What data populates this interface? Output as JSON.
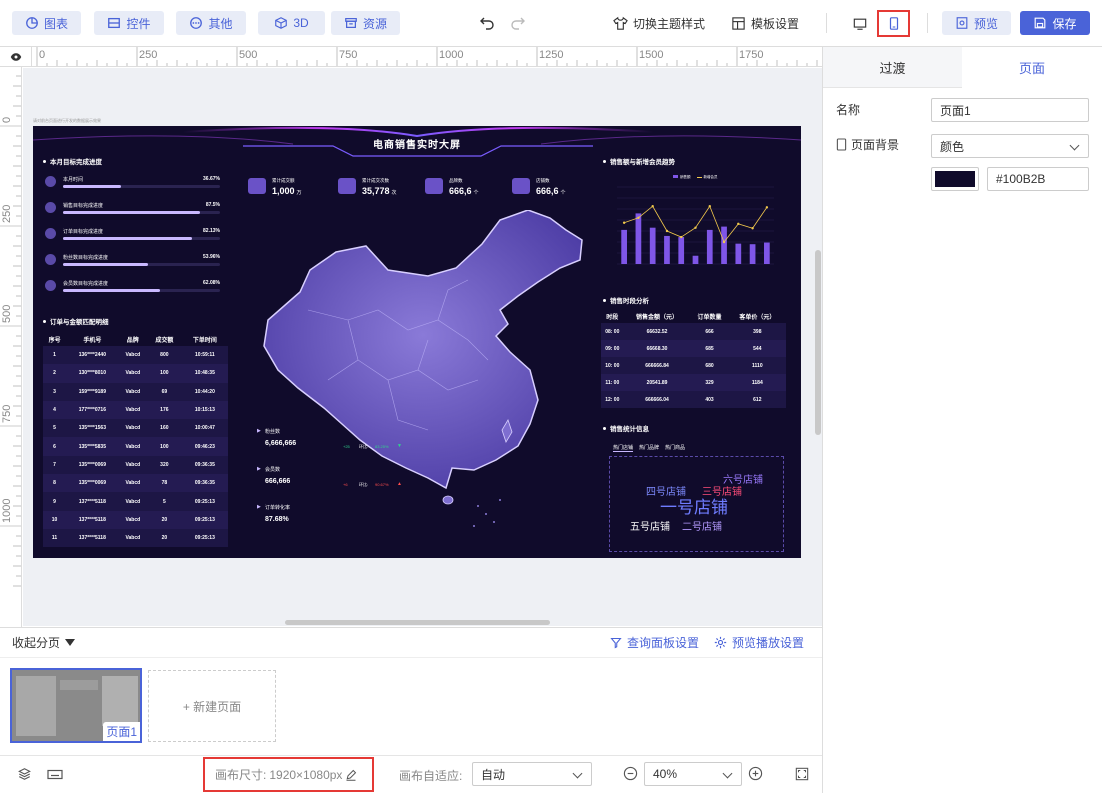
{
  "toolbar": {
    "chart_label": "图表",
    "widget_label": "控件",
    "other_label": "其他",
    "threed_label": "3D",
    "resource_label": "资源",
    "theme_label": "切换主题样式",
    "template_label": "模板设置",
    "preview_label": "预览",
    "save_label": "保存"
  },
  "ruler": {
    "h_ticks": [
      "0",
      "250",
      "500",
      "750",
      "1000",
      "1250",
      "1500",
      "1750"
    ],
    "v_ticks": [
      "0",
      "250",
      "500",
      "750",
      "1000"
    ]
  },
  "dashboard": {
    "hint": "请对前台页面进行开发的数据展示效果",
    "title": "电商销售实时大屏",
    "month_progress_title": "本月目标完成进度",
    "progress": [
      {
        "label": "本月时间",
        "pct": "36.67%",
        "value": 36.67
      },
      {
        "label": "销售目标完成进度",
        "pct": "87.5%",
        "value": 87.5
      },
      {
        "label": "订单目标完成进度",
        "pct": "82.13%",
        "value": 82.13
      },
      {
        "label": "粉丝数目标完成进度",
        "pct": "53.96%",
        "value": 53.96
      },
      {
        "label": "会员数目标完成进度",
        "pct": "62.08%",
        "value": 62.08
      }
    ],
    "orders_title": "订单与金额匹配明细",
    "orders_headers": [
      "序号",
      "手机号",
      "品牌",
      "成交额",
      "下单时间"
    ],
    "orders_rows": [
      [
        "1",
        "136****2440",
        "Vabcd",
        "800",
        "10:59:11"
      ],
      [
        "2",
        "130****8010",
        "Vabcd",
        "100",
        "10:48:35"
      ],
      [
        "3",
        "159****9189",
        "Vabcd",
        "69",
        "10:44:20"
      ],
      [
        "4",
        "177****0716",
        "Vabcd",
        "176",
        "10:15:13"
      ],
      [
        "5",
        "135****1563",
        "Vabcd",
        "160",
        "10:00:47"
      ],
      [
        "6",
        "135****5835",
        "Vabcd",
        "100",
        "09:46:23"
      ],
      [
        "7",
        "135****0069",
        "Vabcd",
        "320",
        "09:36:35"
      ],
      [
        "8",
        "135****0069",
        "Vabcd",
        "78",
        "09:36:35"
      ],
      [
        "9",
        "137****5118",
        "Vabcd",
        "5",
        "09:25:13"
      ],
      [
        "10",
        "137****5118",
        "Vabcd",
        "20",
        "09:25:13"
      ],
      [
        "11",
        "137****5118",
        "Vabcd",
        "20",
        "09:25:13"
      ]
    ],
    "kpis": [
      {
        "label": "累计成交额",
        "value": "1,000",
        "unit": "万"
      },
      {
        "label": "累计成交次数",
        "value": "35,778",
        "unit": "次"
      },
      {
        "label": "品牌数",
        "value": "666,6",
        "unit": "个"
      },
      {
        "label": "店铺数",
        "value": "666,6",
        "unit": "个"
      }
    ],
    "stats": [
      {
        "label": "粉丝数",
        "value": "6,666,666",
        "delta": "+25",
        "ratio_label": "环比:",
        "ratio": "83.25%",
        "dir": "down"
      },
      {
        "label": "会员数",
        "value": "666,666",
        "delta": "+6",
        "ratio_label": "环比:",
        "ratio": "90.67%",
        "dir": "up"
      },
      {
        "label": "订单转化率",
        "value": "87.68%"
      }
    ],
    "trend_title": "销售额与新增会员趋势",
    "trend_legend": [
      "销售额",
      "新增会员"
    ],
    "sales_period_title": "销售时段分析",
    "sales_headers": [
      "时段",
      "销售金额（元）",
      "订单数量",
      "客单价（元）"
    ],
    "sales_rows": [
      [
        "08: 00",
        "66632.52",
        "666",
        "398"
      ],
      [
        "09: 00",
        "66668.30",
        "685",
        "544"
      ],
      [
        "10: 00",
        "666666.84",
        "680",
        "1110"
      ],
      [
        "11: 00",
        "20541.89",
        "329",
        "1184"
      ],
      [
        "12: 00",
        "666666.04",
        "403",
        "612"
      ]
    ],
    "stat_info_title": "销售统计信息",
    "stat_tabs": [
      "热门店铺",
      "热门品牌",
      "热门商品"
    ],
    "words": [
      {
        "text": "六号店铺",
        "color": "#9b7bff"
      },
      {
        "text": "四号店铺",
        "color": "#7e8bff"
      },
      {
        "text": "三号店铺",
        "color": "#ff4d7a"
      },
      {
        "text": "一号店铺",
        "color": "#6f7cff"
      },
      {
        "text": "五号店铺",
        "color": "#ffffff"
      },
      {
        "text": "二号店铺",
        "color": "#b59bff"
      }
    ]
  },
  "chart_data": {
    "type": "bar",
    "title": "销售额与新增会员趋势",
    "categories": [
      "",
      "",
      "",
      "",
      "",
      "",
      "",
      "",
      "",
      "",
      ""
    ],
    "series": [
      {
        "name": "销售额",
        "values": [
          620,
          920,
          660,
          510,
          490,
          150,
          620,
          680,
          370,
          360,
          390
        ]
      },
      {
        "name": "新增会员",
        "values": [
          750,
          840,
          1050,
          600,
          490,
          660,
          1050,
          400,
          730,
          650,
          1030
        ]
      }
    ],
    "ylim": [
      0,
      1400
    ]
  },
  "pages": {
    "collapse_label": "收起分页",
    "query_settings": "查询面板设置",
    "preview_play_settings": "预览播放设置",
    "page1_label": "页面1",
    "new_page_label": "+ 新建页面"
  },
  "bottom": {
    "canvas_size_label": "画布尺寸:",
    "canvas_size_value": "1920×1080px",
    "adapt_label": "画布自适应:",
    "adapt_value": "自动",
    "zoom_value": "40%"
  },
  "right_panel": {
    "tab_transition": "过渡",
    "tab_page": "页面",
    "name_label": "名称",
    "name_value": "页面1",
    "bg_label": "页面背景",
    "bg_type": "颜色",
    "bg_color": "#100B2B",
    "accent": "#4a63d8"
  }
}
